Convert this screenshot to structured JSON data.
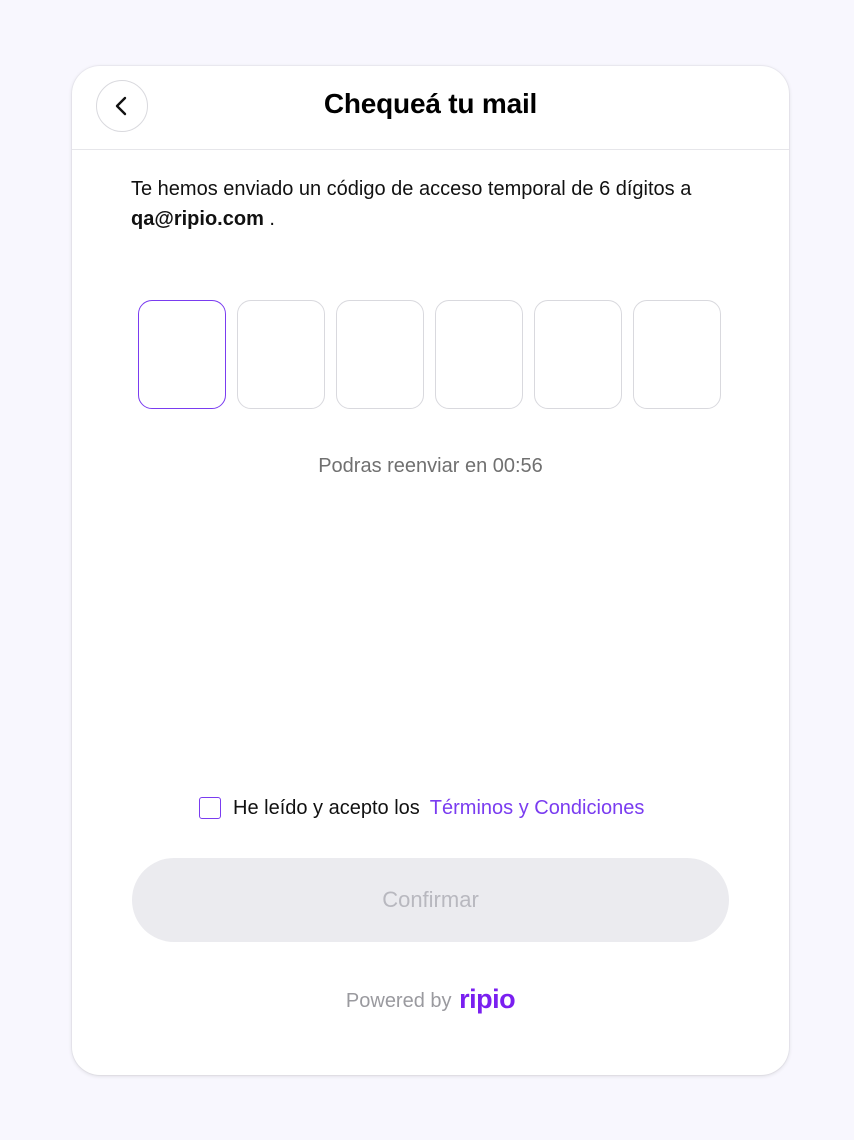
{
  "header": {
    "title": "Chequeá tu mail",
    "back_icon": "chevron-left-icon"
  },
  "description": {
    "text": "Te hemos enviado un código de acceso temporal de 6 dígitos a",
    "email": "qa@ripio.com",
    "suffix": " ."
  },
  "code_inputs": {
    "count": 6,
    "values": [
      "",
      "",
      "",
      "",
      "",
      ""
    ]
  },
  "resend": {
    "text": "Podras reenviar en 00:56"
  },
  "terms": {
    "checked": false,
    "text": "He leído y acepto los",
    "link": "Términos y Condiciones"
  },
  "confirm": {
    "label": "Confirmar",
    "enabled": false
  },
  "footer": {
    "powered_by": "Powered by",
    "brand": "ripio"
  },
  "colors": {
    "accent": "#7a3cf0",
    "brand": "#7a1ff0",
    "background": "#f8f7fe",
    "button_disabled_bg": "#ebebef",
    "button_disabled_text": "#b8b8bf"
  }
}
